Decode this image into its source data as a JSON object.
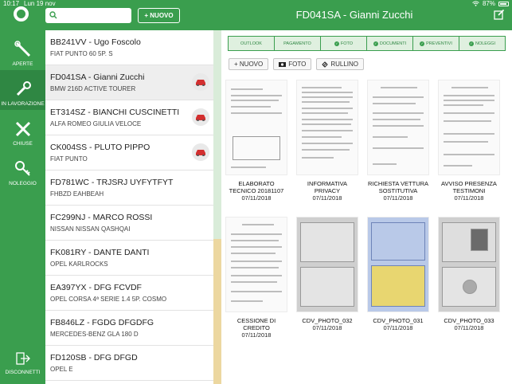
{
  "status": {
    "time": "10:17",
    "date": "Lun 19 nov",
    "battery": "87%"
  },
  "header": {
    "new_label": "+ NUOVO",
    "title": "FD041SA - Gianni Zucchi",
    "search_placeholder": ""
  },
  "sidebar": {
    "items": [
      {
        "label": "APERTE",
        "icon": "tools-icon"
      },
      {
        "label": "IN LAVORAZIONE",
        "icon": "wrench-icon"
      },
      {
        "label": "CHIUSE",
        "icon": "crossed-tools-icon"
      },
      {
        "label": "NOLEGGIO",
        "icon": "key-icon"
      }
    ],
    "logout_label": "DISCONNETTI"
  },
  "list": [
    {
      "title": "BB241VV - Ugo Foscolo",
      "subtitle": "FIAT PUNTO 60 5P. S",
      "car": false
    },
    {
      "title": "FD041SA - Gianni Zucchi",
      "subtitle": "BMW 216D ACTIVE TOURER",
      "car": true
    },
    {
      "title": "ET314SZ - BIANCHI CUSCINETTI",
      "subtitle": "ALFA ROMEO GIULIA VELOCE",
      "car": true
    },
    {
      "title": "CK004SS - PLUTO PIPPO",
      "subtitle": "FIAT PUNTO",
      "car": true
    },
    {
      "title": "FD781WC - TRJSRJ UYFYTFYT",
      "subtitle": "FHBZD EAHBEAH",
      "car": false
    },
    {
      "title": "FC299NJ - MARCO ROSSI",
      "subtitle": "NISSAN NISSAN QASHQAI",
      "car": false
    },
    {
      "title": "FK081RY - DANTE DANTI",
      "subtitle": "OPEL KARLROCKS",
      "car": false
    },
    {
      "title": "EA397YX - DFG FCVDF",
      "subtitle": "OPEL CORSA 4ª SERIE 1.4 5P. COSMO",
      "car": false
    },
    {
      "title": "FB846LZ - FGDG DFGDFG",
      "subtitle": "MERCEDES-BENZ GLA 180 D",
      "car": false
    },
    {
      "title": "FD120SB - DFG DFGD",
      "subtitle": "OPEL E",
      "car": false
    }
  ],
  "tabs": [
    {
      "label": "OUTLOOK",
      "done": false
    },
    {
      "label": "PAGAMENTO",
      "done": false
    },
    {
      "label": "FOTO",
      "done": true
    },
    {
      "label": "DOCUMENTI",
      "done": true
    },
    {
      "label": "PREVENTIVI",
      "done": true
    },
    {
      "label": "NOLEGGI",
      "done": true
    }
  ],
  "actions": {
    "new": "+ NUOVO",
    "photo": "FOTO",
    "roll": "RULLINO"
  },
  "documents": [
    {
      "name": "ELABORATO TECNICO 20181107",
      "date": "07/11/2018",
      "kind": "form"
    },
    {
      "name": "INFORMATIVA PRIVACY",
      "date": "07/11/2018",
      "kind": "form"
    },
    {
      "name": "RICHIESTA VETTURA SOSTITUTIVA",
      "date": "07/11/2018",
      "kind": "form"
    },
    {
      "name": "AVVISO PRESENZA TESTIMONI",
      "date": "07/11/2018",
      "kind": "form"
    },
    {
      "name": "CESSIONE DI CREDITO",
      "date": "07/11/2018",
      "kind": "form"
    },
    {
      "name": "CDV_PHOTO_032",
      "date": "07/11/2018",
      "kind": "photo"
    },
    {
      "name": "CDV_PHOTO_031",
      "date": "07/11/2018",
      "kind": "blue"
    },
    {
      "name": "CDV_PHOTO_033",
      "date": "07/11/2018",
      "kind": "photo"
    }
  ],
  "colors": {
    "brand": "#3a9e4e",
    "brand_dark": "#2f8743",
    "car_icon": "#d32f2f"
  }
}
